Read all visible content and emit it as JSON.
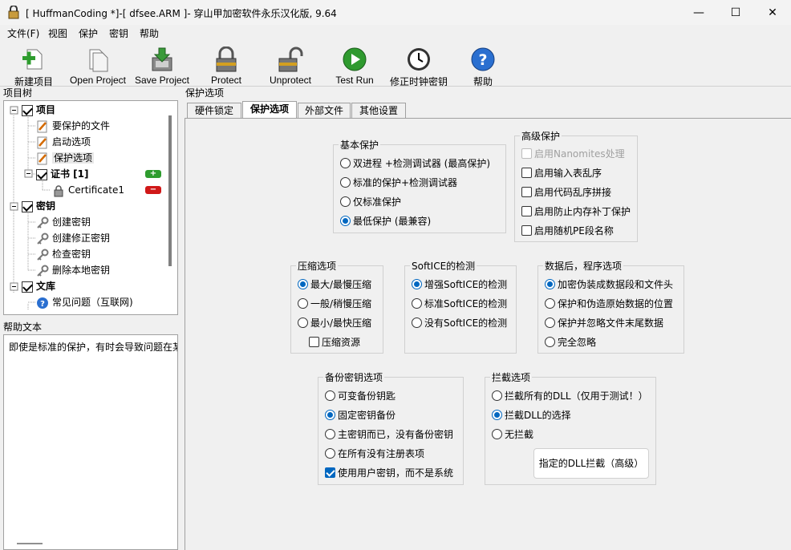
{
  "window": {
    "title": "[ HuffmanCoding *]-[ dfsee.ARM ]- 穿山甲加密软件永乐汉化版, 9.64",
    "controls": {
      "minimize": "—",
      "maximize": "☐",
      "close": "✕"
    }
  },
  "menu": [
    "文件(F)",
    "视图",
    "保护",
    "密钥",
    "帮助"
  ],
  "toolbar": [
    {
      "label": "新建项目",
      "icon": "new-project-icon"
    },
    {
      "label": "Open Project",
      "icon": "open-project-icon"
    },
    {
      "label": "Save Project",
      "icon": "save-project-icon"
    },
    {
      "label": "Protect",
      "icon": "lock-icon"
    },
    {
      "label": "Unprotect",
      "icon": "unlock-icon"
    },
    {
      "label": "Test Run",
      "icon": "play-icon"
    },
    {
      "label": "修正时钟密钥",
      "icon": "clock-icon"
    },
    {
      "label": "帮助",
      "icon": "help-icon"
    }
  ],
  "tree": {
    "header": "项目树",
    "items": [
      {
        "label": "项目",
        "bold": true
      },
      {
        "label": "要保护的文件"
      },
      {
        "label": "启动选项"
      },
      {
        "label": "保护选项",
        "selected": true
      },
      {
        "label": "证书 [1]",
        "bold": true
      },
      {
        "label": "Certificate1"
      },
      {
        "label": "密钥",
        "bold": true
      },
      {
        "label": "创建密钥"
      },
      {
        "label": "创建修正密钥"
      },
      {
        "label": "检查密钥"
      },
      {
        "label": "删除本地密钥"
      },
      {
        "label": "文库",
        "bold": true
      },
      {
        "label": "常见问题（互联网)"
      }
    ],
    "add_badge": "+",
    "remove_badge": "−"
  },
  "help": {
    "header": "帮助文本",
    "text": "即使是标准的保护，有时会导致问题在某"
  },
  "main": {
    "header": "保护选项",
    "tabs": [
      "硬件锁定",
      "保护选项",
      "外部文件",
      "其他设置"
    ],
    "basic": {
      "title": "基本保护",
      "options": [
        "双进程 +检测调试器 (最高保护)",
        "标准的保护+检测调试器",
        "仅标准保护",
        "最低保护 (最兼容)"
      ]
    },
    "advanced": {
      "title": "高级保护",
      "options": [
        "启用Nanomites处理",
        "启用输入表乱序",
        "启用代码乱序拼接",
        "启用防止内存补丁保护",
        "启用随机PE段名称"
      ]
    },
    "compress": {
      "title": "压缩选项",
      "options": [
        "最大/最慢压缩",
        "一般/稍慢压缩",
        "最小/最快压缩"
      ],
      "check": "压缩资源"
    },
    "softice": {
      "title": "SoftICE的检测",
      "options": [
        "增强SoftICE的检测",
        "标准SoftICE的检测",
        "没有SoftICE的检测"
      ]
    },
    "afterdata": {
      "title": "数据后，程序选项",
      "options": [
        "加密伪装成数据段和文件头",
        "保护和伪造原始数据的位置",
        "保护并忽略文件末尾数据",
        "完全忽略"
      ]
    },
    "backup": {
      "title": "备份密钥选项",
      "options": [
        "可变备份钥匙",
        "固定密钥备份",
        "主密钥而已，没有备份密钥",
        "在所有没有注册表项"
      ],
      "check": "使用用户密钥，而不是系统"
    },
    "intercept": {
      "title": "拦截选项",
      "options": [
        "拦截所有的DLL（仅用于测试！）",
        "拦截DLL的选择",
        "无拦截"
      ],
      "button": "指定的DLL拦截（高级）"
    }
  },
  "colors": {
    "accent": "#0067c0",
    "background": "#f0f0f0"
  }
}
